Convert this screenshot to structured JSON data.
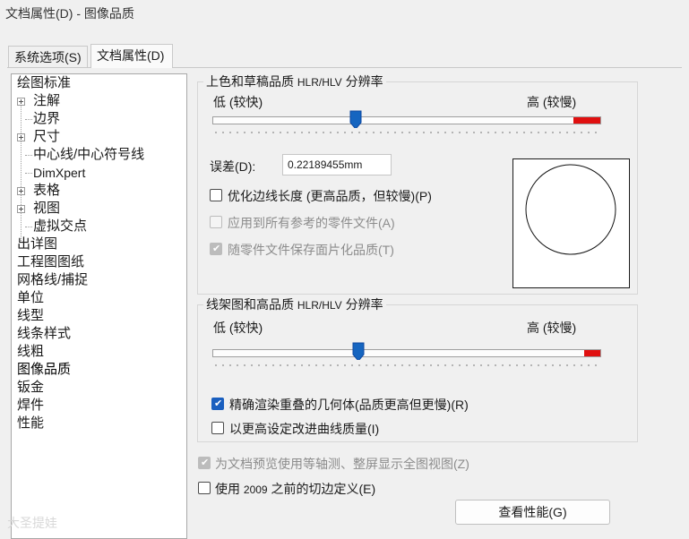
{
  "window": {
    "title": "文档属性(D) - 图像品质"
  },
  "tabs": [
    {
      "label": "系统选项(S)"
    },
    {
      "label": "文档属性(D)"
    }
  ],
  "tree": {
    "items": [
      {
        "label": "绘图标准"
      },
      {
        "label": "注解"
      },
      {
        "label": "边界"
      },
      {
        "label": "尺寸"
      },
      {
        "label": "中心线/中心符号线"
      },
      {
        "label": "DimXpert"
      },
      {
        "label": "表格"
      },
      {
        "label": "视图"
      },
      {
        "label": "虚拟交点"
      },
      {
        "label": "出详图"
      },
      {
        "label": "工程图图纸"
      },
      {
        "label": "网格线/捕捉"
      },
      {
        "label": "单位"
      },
      {
        "label": "线型"
      },
      {
        "label": "线条样式"
      },
      {
        "label": "线粗"
      },
      {
        "label": "图像品质"
      },
      {
        "label": "钣金"
      },
      {
        "label": "焊件"
      },
      {
        "label": "性能"
      }
    ]
  },
  "shaded_group": {
    "title_prefix": "上色和草稿品质",
    "title_small": "HLR/HLV",
    "title_suffix": "分辨率",
    "low_label": "低 (较快)",
    "high_label": "高 (较慢)",
    "slider_level_fraction": 0.4,
    "deviation_label": "误差(D):",
    "deviation_value": "0.22189455mm",
    "optimize_label": "优化边线长度 (更高品质，但较慢)(P)",
    "apply_all_label": "应用到所有参考的零件文件(A)",
    "save_tess_label": "随零件文件保存面片化品质(T)"
  },
  "wireframe_group": {
    "title_prefix": "线架图和高品质",
    "title_small": "HLR/HLV",
    "title_suffix": "分辨率",
    "low_label": "低 (较快)",
    "high_label": "高 (较慢)",
    "slider_level_fraction": 0.4,
    "precise_label": "精确渲染重叠的几何体(品质更高但更慢)(R)",
    "improve_curve_label": "以更高设定改进曲线质量(I)"
  },
  "bottom": {
    "iso_label": "为文档预览使用等轴测、整屏显示全图视图(Z)",
    "pre2009_prefix": "使用",
    "pre2009_small": "2009",
    "pre2009_suffix": "之前的切边定义(E)",
    "perf_button": "查看性能(G)"
  },
  "watermark": "大圣提娃",
  "colors": {
    "slider_thumb": "#1565c0",
    "slider_high_range": "#e01010",
    "checkbox_checked": "#1a5fbf"
  }
}
